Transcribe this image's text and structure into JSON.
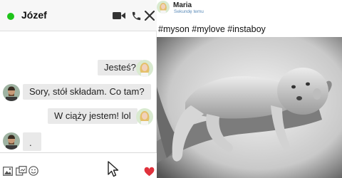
{
  "chat": {
    "contact_name": "Józef",
    "status_color": "#1fc41a",
    "header_icons": [
      "video-camera-icon",
      "phone-icon",
      "close-icon"
    ],
    "messages": [
      {
        "from": "me",
        "text": "Jesteś?"
      },
      {
        "from": "contact",
        "text": "Sory, stół składam. Co tam?"
      },
      {
        "from": "me",
        "text": "W ciąży jestem! lol"
      },
      {
        "from": "contact",
        "text": "."
      }
    ],
    "composer_icons": [
      "photo-icon",
      "sticker-icon",
      "emoji-icon",
      "like-heart-icon"
    ],
    "like_color": "#e0313c"
  },
  "post": {
    "author": "Maria",
    "time": "Sekundę temu",
    "text": "#myson #mylove #instaboy",
    "image": "baby-lying-on-forearm-photo"
  }
}
